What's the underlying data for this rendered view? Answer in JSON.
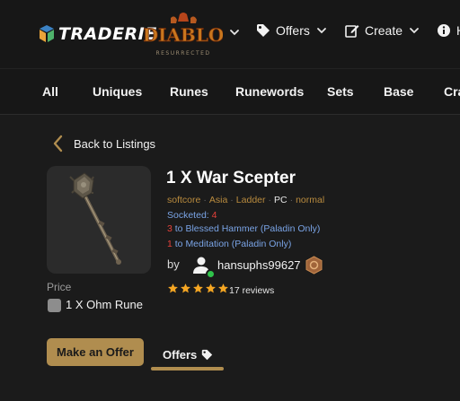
{
  "header": {
    "brand": "TRADERIE",
    "game_logo_text": "DIABLO",
    "game_logo_sub": "RESURRECTED",
    "nav": [
      {
        "label": "Offers",
        "icon": "tag-icon"
      },
      {
        "label": "Create",
        "icon": "edit-icon"
      },
      {
        "label": "H",
        "icon": "info-icon"
      }
    ]
  },
  "categories": [
    "All",
    "Uniques",
    "Runes",
    "Runewords",
    "Sets",
    "Base",
    "Cra"
  ],
  "back_label": "Back to Listings",
  "item": {
    "title": "1 X War Scepter",
    "properties": [
      "softcore",
      "Asia",
      "Ladder",
      "PC",
      "normal"
    ],
    "socketed_label": "Socketed:",
    "socketed_value": "4",
    "stats": [
      {
        "value": "3",
        "text": "to Blessed Hammer (Paladin Only)"
      },
      {
        "value": "1",
        "text": "to Meditation (Paladin Only)"
      }
    ]
  },
  "seller": {
    "by_label": "by",
    "username": "hansuphs99627",
    "online": true,
    "rating": 5,
    "reviews": "17 reviews"
  },
  "price": {
    "label": "Price",
    "value": "1 X Ohm Rune"
  },
  "actions": {
    "make_offer": "Make an Offer",
    "offers_tab": "Offers"
  },
  "colors": {
    "accent": "#b08d4f",
    "property": "#b98b3e",
    "magic_blue": "#7aa4e6",
    "red_value": "#e5413a",
    "star": "#f5a623",
    "online": "#2fc34a"
  }
}
